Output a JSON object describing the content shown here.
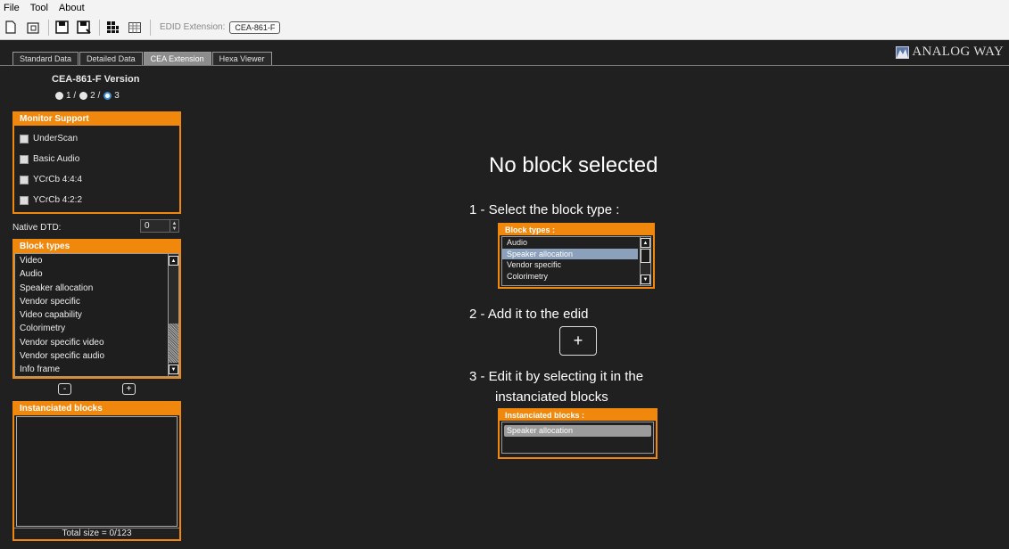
{
  "menu": [
    "File",
    "Tool",
    "About"
  ],
  "toolbar": {
    "icons": [
      "new-file-icon",
      "open-file-icon",
      "save-icon",
      "save-as-icon",
      "grid-view-icon",
      "table-view-icon"
    ],
    "edid_label": "EDID Extension:",
    "edid_value": "CEA-861-F"
  },
  "tabs": [
    "Standard Data",
    "Detailed Data",
    "CEA Extension",
    "Hexa Viewer"
  ],
  "active_tab": "CEA Extension",
  "logo": "ANALOG WAY",
  "version": {
    "title": "CEA-861-F Version",
    "options": [
      "1 /",
      "2 /",
      "3"
    ],
    "selected": "3"
  },
  "monitor_support": {
    "title": "Monitor Support",
    "items": [
      "UnderScan",
      "Basic Audio",
      "YCrCb 4:4:4",
      "YCrCb 4:2:2"
    ]
  },
  "native_dtd": {
    "label": "Native DTD:",
    "value": "0"
  },
  "block_types": {
    "title": "Block types",
    "items": [
      "Video",
      "Audio",
      "Speaker allocation",
      "Vendor specific",
      "Video capability",
      "Colorimetry",
      "Vendor specific video",
      "Vendor specific audio",
      "Info frame"
    ]
  },
  "buttons": {
    "remove": "-",
    "add": "+"
  },
  "instanciated": {
    "title": "Instanciated blocks",
    "total": "Total size = 0/123"
  },
  "help": {
    "title": "No block selected",
    "step1": "1 - Select the block type :",
    "step2": "2 - Add it to the edid",
    "step3a": "3 - Edit it by selecting it in the",
    "step3b": "instanciated blocks",
    "mini_block_title": "Block types :",
    "mini_block_items": [
      "Audio",
      "Speaker allocation",
      "Vendor specific",
      "Colorimetry"
    ],
    "plus": "+",
    "mini_inst_title": "Instanciated blocks :",
    "mini_inst_item": "Speaker allocation"
  },
  "colors": {
    "accent": "#f0880e",
    "background": "#202020",
    "selection": "#8aa0bb"
  }
}
